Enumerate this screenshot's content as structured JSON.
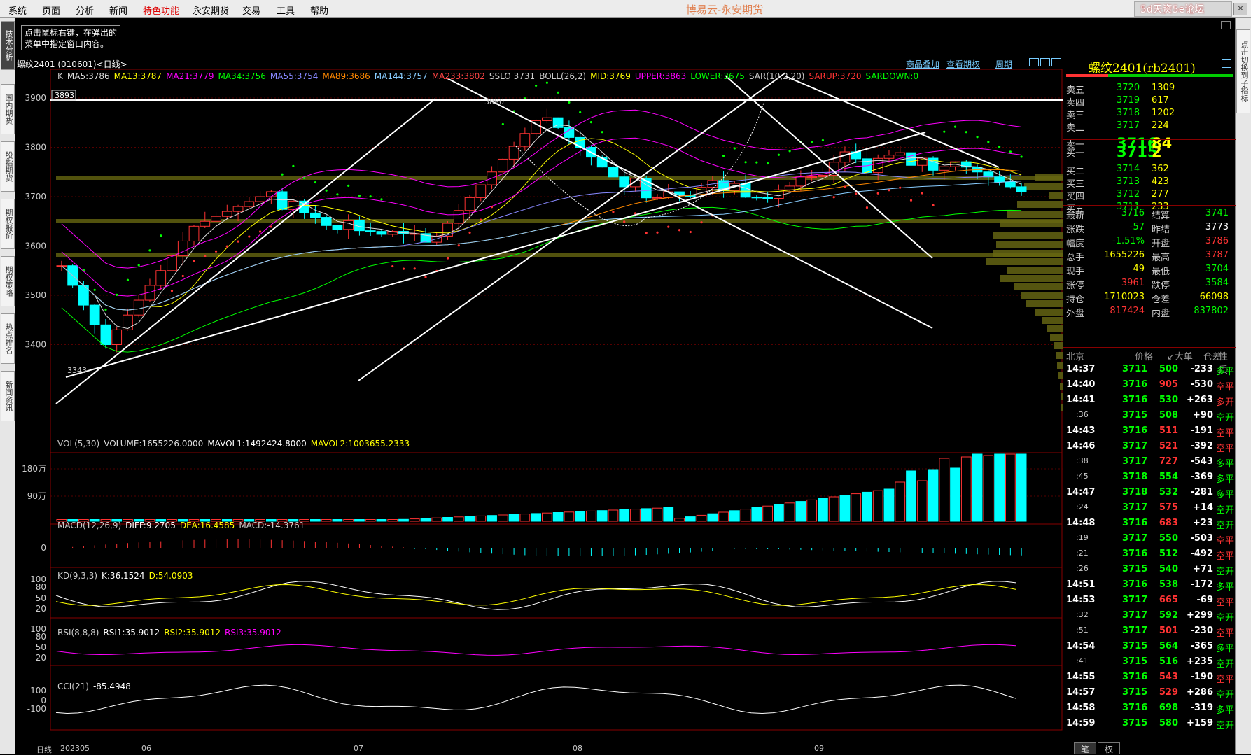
{
  "menu": [
    "系统",
    "页面",
    "分析",
    "新闻",
    "特色功能",
    "永安期货",
    "交易",
    "工具",
    "帮助"
  ],
  "app_title": "博易云-永安期货",
  "brand": "5d天资5e论坛",
  "left_tabs": [
    "技术分析",
    "国内期货",
    "股指期货",
    "期权报价",
    "期权策略",
    "热点排名",
    "新闻资讯"
  ],
  "right_tabs": [
    "点击切换到子指标"
  ],
  "hint": "点击鼠标右键，在弹出的菜单中指定窗口内容。",
  "chart": {
    "title": "螺纹2401 (010601)<日线>",
    "links": [
      "商品叠加",
      "查看期权",
      "周期"
    ],
    "label_3893": "3893",
    "label_3890": "3890",
    "label_3343": "3343",
    "price_axis": [
      "3900",
      "3800",
      "3700",
      "3600",
      "3500",
      "3400"
    ],
    "vol_axis": [
      "180万",
      "90万"
    ],
    "macd_axis": [
      "0"
    ],
    "kd_axis": [
      "100",
      "80",
      "50",
      "20"
    ],
    "rsi_axis": [
      "100",
      "80",
      "50",
      "20"
    ],
    "cci_axis": [
      "100",
      "0",
      "-100"
    ],
    "date_axis": [
      "202305",
      "06",
      "07",
      "08",
      "09"
    ],
    "period": "日线"
  },
  "indicators": {
    "k": [
      {
        "t": "K",
        "c": "#ccc"
      },
      {
        "t": "MA5:3786",
        "c": "#ddd"
      },
      {
        "t": "MA13:3787",
        "c": "#ff0"
      },
      {
        "t": "MA21:3779",
        "c": "#f0f"
      },
      {
        "t": "MA34:3756",
        "c": "#0f0"
      },
      {
        "t": "MA55:3754",
        "c": "#88f"
      },
      {
        "t": "MA89:3686",
        "c": "#f80"
      },
      {
        "t": "MA144:3757",
        "c": "#8cf"
      },
      {
        "t": "MA233:3802",
        "c": "#f44"
      },
      {
        "t": "SSLO 3731",
        "c": "#ccc"
      },
      {
        "t": "BOLL(26,2)",
        "c": "#ccc"
      },
      {
        "t": "MID:3769",
        "c": "#ff0"
      },
      {
        "t": "UPPER:3863",
        "c": "#f0f"
      },
      {
        "t": "LOWER:3675",
        "c": "#0f0"
      },
      {
        "t": "SAR(10,2,20)",
        "c": "#ccc"
      },
      {
        "t": "SARUP:3720",
        "c": "#f33"
      },
      {
        "t": "SARDOWN:0",
        "c": "#0f0"
      }
    ],
    "vol": [
      {
        "t": "VOL(5,30)",
        "c": "#ccc"
      },
      {
        "t": "VOLUME:1655226.0000",
        "c": "#ddd"
      },
      {
        "t": "MAVOL1:1492424.8000",
        "c": "#fff"
      },
      {
        "t": "MAVOL2:1003655.2333",
        "c": "#ff0"
      }
    ],
    "macd": [
      {
        "t": "MACD(12,26,9)",
        "c": "#ccc"
      },
      {
        "t": "DIFF:9.2705",
        "c": "#fff"
      },
      {
        "t": "DEA:16.4585",
        "c": "#ff0"
      },
      {
        "t": "MACD:-14.3761",
        "c": "#ccc"
      }
    ],
    "kd": [
      {
        "t": "KD(9,3,3)",
        "c": "#ccc"
      },
      {
        "t": "K:36.1524",
        "c": "#fff"
      },
      {
        "t": "D:54.0903",
        "c": "#ff0"
      }
    ],
    "rsi": [
      {
        "t": "RSI(8,8,8)",
        "c": "#ccc"
      },
      {
        "t": "RSI1:35.9012",
        "c": "#fff"
      },
      {
        "t": "RSI2:35.9012",
        "c": "#ff0"
      },
      {
        "t": "RSI3:35.9012",
        "c": "#f0f"
      }
    ],
    "cci": [
      {
        "t": "CCI(21)",
        "c": "#ccc"
      },
      {
        "t": "-85.4948",
        "c": "#fff"
      }
    ]
  },
  "quote": {
    "title": "螺纹2401(rb2401)",
    "asks": [
      {
        "l": "卖五",
        "p": "3720",
        "v": "1309"
      },
      {
        "l": "卖四",
        "p": "3719",
        "v": "617"
      },
      {
        "l": "卖三",
        "p": "3718",
        "v": "1202"
      },
      {
        "l": "卖二",
        "p": "3717",
        "v": "224"
      },
      {
        "l": "卖一",
        "p": "3716",
        "v": "84"
      }
    ],
    "bids": [
      {
        "l": "买一",
        "p": "3715",
        "v": "2"
      },
      {
        "l": "买二",
        "p": "3714",
        "v": "362"
      },
      {
        "l": "买三",
        "p": "3713",
        "v": "423"
      },
      {
        "l": "买四",
        "p": "3712",
        "v": "277"
      },
      {
        "l": "买五",
        "p": "3711",
        "v": "233"
      }
    ],
    "stats": [
      {
        "a": "最新",
        "b": "3716",
        "bc": "g",
        "c": "结算",
        "d": "3741",
        "dc": "g"
      },
      {
        "a": "涨跌",
        "b": "-57",
        "bc": "g",
        "c": "昨结",
        "d": "3773",
        "dc": "w"
      },
      {
        "a": "幅度",
        "b": "-1.51%",
        "bc": "g",
        "c": "开盘",
        "d": "3786",
        "dc": "r"
      },
      {
        "a": "总手",
        "b": "1655226",
        "bc": "y",
        "c": "最高",
        "d": "3787",
        "dc": "r"
      },
      {
        "a": "现手",
        "b": "49",
        "bc": "y",
        "c": "最低",
        "d": "3704",
        "dc": "g"
      },
      {
        "a": "涨停",
        "b": "3961",
        "bc": "r",
        "c": "跌停",
        "d": "3584",
        "dc": "g"
      },
      {
        "a": "持仓",
        "b": "1710023",
        "bc": "y",
        "c": "仓差",
        "d": "66098",
        "dc": "y"
      },
      {
        "a": "外盘",
        "b": "817424",
        "bc": "r",
        "c": "内盘",
        "d": "837802",
        "dc": "g"
      }
    ],
    "tick_header": [
      "北京",
      "价格",
      "↙大单",
      "仓差",
      "性质"
    ],
    "ticks": [
      {
        "t": "14:37",
        "p": "3711",
        "v": "500",
        "d": "-233",
        "k": "多平",
        "kc": "g"
      },
      {
        "t": "14:40",
        "p": "3716",
        "v": "905",
        "d": "-530",
        "k": "空平",
        "kc": "r"
      },
      {
        "t": "14:41",
        "p": "3716",
        "v": "530",
        "d": "+263",
        "k": "多开",
        "kc": "r"
      },
      {
        "t": ":36",
        "p": "3715",
        "v": "508",
        "d": "+90",
        "k": "空开",
        "kc": "g"
      },
      {
        "t": "14:43",
        "p": "3716",
        "v": "511",
        "d": "-191",
        "k": "空平",
        "kc": "r"
      },
      {
        "t": "14:46",
        "p": "3717",
        "v": "521",
        "d": "-392",
        "k": "空平",
        "kc": "r"
      },
      {
        "t": ":38",
        "p": "3717",
        "v": "727",
        "d": "-543",
        "k": "多平",
        "kc": "g"
      },
      {
        "t": ":45",
        "p": "3718",
        "v": "554",
        "d": "-369",
        "k": "多平",
        "kc": "g"
      },
      {
        "t": "14:47",
        "p": "3718",
        "v": "532",
        "d": "-281",
        "k": "多平",
        "kc": "g"
      },
      {
        "t": ":24",
        "p": "3717",
        "v": "575",
        "d": "+14",
        "k": "空开",
        "kc": "g"
      },
      {
        "t": "14:48",
        "p": "3716",
        "v": "683",
        "d": "+23",
        "k": "空开",
        "kc": "g"
      },
      {
        "t": ":19",
        "p": "3717",
        "v": "550",
        "d": "-503",
        "k": "空平",
        "kc": "r"
      },
      {
        "t": ":21",
        "p": "3716",
        "v": "512",
        "d": "-492",
        "k": "空平",
        "kc": "r"
      },
      {
        "t": ":26",
        "p": "3715",
        "v": "540",
        "d": "+71",
        "k": "空开",
        "kc": "g"
      },
      {
        "t": "14:51",
        "p": "3716",
        "v": "538",
        "d": "-172",
        "k": "多平",
        "kc": "g"
      },
      {
        "t": "14:53",
        "p": "3717",
        "v": "665",
        "d": "-69",
        "k": "空平",
        "kc": "r"
      },
      {
        "t": ":32",
        "p": "3717",
        "v": "592",
        "d": "+299",
        "k": "空开",
        "kc": "g"
      },
      {
        "t": ":51",
        "p": "3717",
        "v": "501",
        "d": "-230",
        "k": "空平",
        "kc": "r"
      },
      {
        "t": "14:54",
        "p": "3715",
        "v": "564",
        "d": "-365",
        "k": "多平",
        "kc": "g"
      },
      {
        "t": ":41",
        "p": "3715",
        "v": "516",
        "d": "+235",
        "k": "空开",
        "kc": "g"
      },
      {
        "t": "14:55",
        "p": "3716",
        "v": "543",
        "d": "-190",
        "k": "空平",
        "kc": "r"
      },
      {
        "t": "14:57",
        "p": "3715",
        "v": "529",
        "d": "+286",
        "k": "空开",
        "kc": "g"
      },
      {
        "t": "14:58",
        "p": "3716",
        "v": "698",
        "d": "-319",
        "k": "多平",
        "kc": "g"
      },
      {
        "t": "14:59",
        "p": "3715",
        "v": "580",
        "d": "+159",
        "k": "空开",
        "kc": "g"
      }
    ],
    "bottom_tabs": [
      "笔",
      "权"
    ]
  },
  "colors": {
    "up": "#f33",
    "down": "#0ff",
    "frame": "#800"
  }
}
